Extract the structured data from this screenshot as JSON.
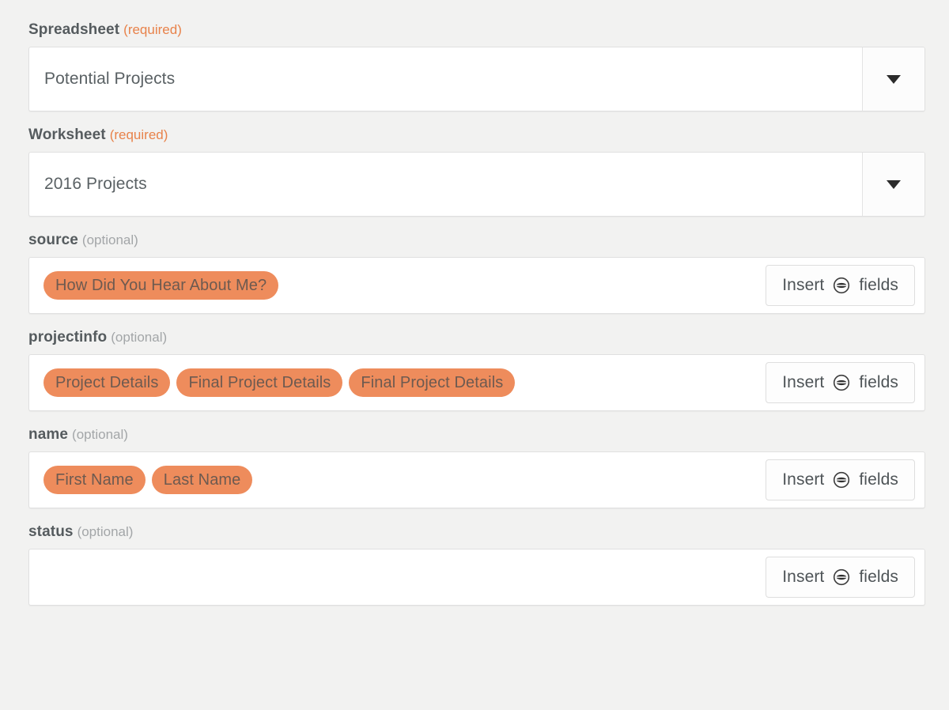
{
  "form": {
    "fields": [
      {
        "label": "Spreadsheet",
        "requirement": "(required)",
        "requirement_kind": "required",
        "type": "select",
        "value": "Potential Projects",
        "arrow_icon": "chevron-down-icon"
      },
      {
        "label": "Worksheet",
        "requirement": "(required)",
        "requirement_kind": "required",
        "type": "select",
        "value": "2016 Projects",
        "arrow_icon": "chevron-down-icon"
      },
      {
        "label": "source",
        "requirement": "(optional)",
        "requirement_kind": "optional",
        "type": "tokens",
        "tokens": [
          "How Did You Hear About Me?"
        ],
        "insert_button": {
          "prefix": "Insert",
          "icon": "insert-field-icon",
          "suffix": "fields"
        }
      },
      {
        "label": "projectinfo",
        "requirement": "(optional)",
        "requirement_kind": "optional",
        "type": "tokens",
        "tokens": [
          "Project Details",
          "Final Project Details",
          "Final Project Details"
        ],
        "insert_button": {
          "prefix": "Insert",
          "icon": "insert-field-icon",
          "suffix": "fields"
        }
      },
      {
        "label": "name",
        "requirement": "(optional)",
        "requirement_kind": "optional",
        "type": "tokens",
        "tokens": [
          "First Name",
          "Last Name"
        ],
        "insert_button": {
          "prefix": "Insert",
          "icon": "insert-field-icon",
          "suffix": "fields"
        }
      },
      {
        "label": "status",
        "requirement": "(optional)",
        "requirement_kind": "optional",
        "type": "tokens",
        "tokens": [],
        "insert_button": {
          "prefix": "Insert",
          "icon": "insert-field-icon",
          "suffix": "fields"
        }
      }
    ]
  },
  "colors": {
    "page_background": "#f2f2f1",
    "token_background": "#ee8c5c",
    "token_text": "#6d5a50",
    "required_text": "#e8824a",
    "optional_text": "#a3a6a8",
    "label_text": "#555b5e",
    "field_background": "#ffffff",
    "field_border": "#e0e0e0"
  }
}
